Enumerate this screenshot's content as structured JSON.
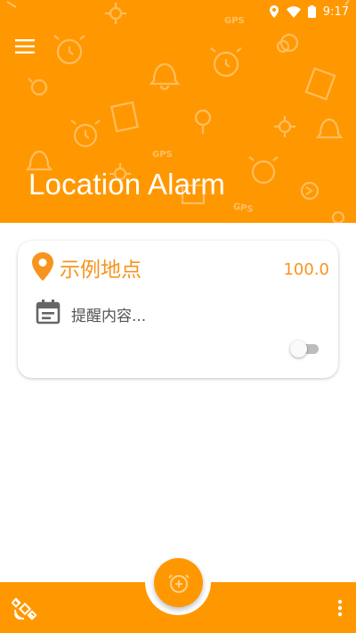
{
  "status_bar": {
    "time": "9:17"
  },
  "header": {
    "title": "Location Alarm",
    "background_color": "#ff9800",
    "watermark_text": "GPS"
  },
  "toolbar": {
    "menu_icon": "hamburger-menu-icon"
  },
  "alarm_list": [
    {
      "place_name": "示例地点",
      "distance": "100.0",
      "reminder_placeholder": "提醒内容...",
      "enabled": false,
      "accent_color": "#f7941d"
    }
  ],
  "bottom_bar": {
    "fab_icon": "add-alarm-icon",
    "left_icon": "satellite-icon",
    "right_icon": "more-vertical-icon",
    "color": "#ff9800"
  }
}
